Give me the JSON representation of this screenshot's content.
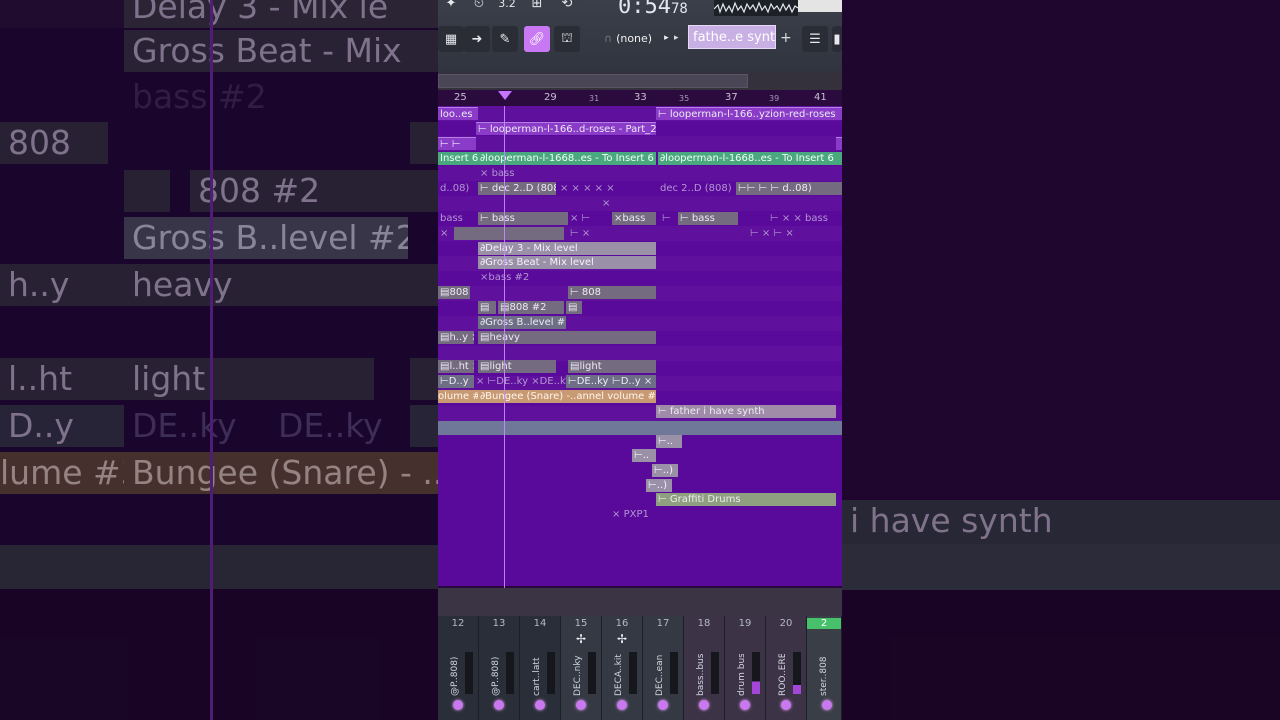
{
  "toolbar": {
    "time_main": "0:54",
    "time_frac": "78",
    "tempo_label": "3.2",
    "pattern_none": "(none)",
    "channel_name": "fathe..e synth",
    "plus": "+",
    "arrow": "▶",
    "arrow_small": "▸"
  },
  "ruler": {
    "major": [
      "25",
      "29",
      "33",
      "37",
      "41"
    ],
    "minor": [
      "31",
      "35",
      "39"
    ]
  },
  "clips": {
    "loo_es": "loo..es",
    "roses_part2": "looperman-l-166..d-roses - Part_2",
    "yzion_roses": "looperman-l-166..yzion-red-roses",
    "insert6": "Insert 6",
    "to_insert6_a": "looperman-l-1668..es - To Insert 6",
    "to_insert6_b": "looperman-l-1668..es - To Insert 6",
    "bass": "bass",
    "d08": "d..08)",
    "dec2_808": "dec 2..D (808)",
    "delay3": "Delay 3 - Mix level",
    "grossbeat": "Gross Beat - Mix level",
    "bass2": "bass #2",
    "c808": "808",
    "c808_2": "808 #2",
    "grossb_level2": "Gross B..level #2",
    "hy": "h..y",
    "heavy": "heavy",
    "lht": "l..ht",
    "light": "light",
    "dy": "D..y",
    "deky": "DE..ky",
    "volume3": "olume #3",
    "bungee": "Bungee (Snare) -..annel volume #2",
    "father_synth": "father i have synth",
    "graffiti": "Graffiti Drums",
    "pxp1": "PXP1",
    "dots": "..)",
    "x": "×"
  },
  "side_left": {
    "delay_text": "Delay 3 - Mix le",
    "gross_text": "Gross Beat - Mix",
    "bass2_text": "bass #2",
    "c808_text": "808",
    "c808_2_text": "808 #2",
    "grossb_text": "Gross B..level #2",
    "hy_text": "h..y",
    "heavy_text": "heavy",
    "lht_text": "l..ht",
    "light_text": "light",
    "dy_text": "D..y",
    "deky_text": "DE..ky",
    "deky2_text": "DE..ky",
    "volume_text": "lume #3",
    "bungee_text": "Bungee (Snare) - .."
  },
  "side_right": {
    "synth_text": "i have synth"
  },
  "mixer": {
    "channels": [
      {
        "num": "12",
        "name": "@P..808)"
      },
      {
        "num": "13",
        "name": "@P..808)"
      },
      {
        "num": "14",
        "name": "cart..latt"
      },
      {
        "num": "15",
        "name": "DEC..nky"
      },
      {
        "num": "16",
        "name": "DECA..kit"
      },
      {
        "num": "17",
        "name": "DEC..ean"
      },
      {
        "num": "18",
        "name": "bass..bus"
      },
      {
        "num": "19",
        "name": "drum bus"
      },
      {
        "num": "20",
        "name": "ROO..ERB"
      },
      {
        "num": "2",
        "name": "ster..808"
      }
    ]
  },
  "colors": {
    "accent": "#c778f2",
    "track_bg": "#5a0a9a",
    "clip_purple": "#8a3cc9",
    "clip_green": "#4aa87e"
  }
}
